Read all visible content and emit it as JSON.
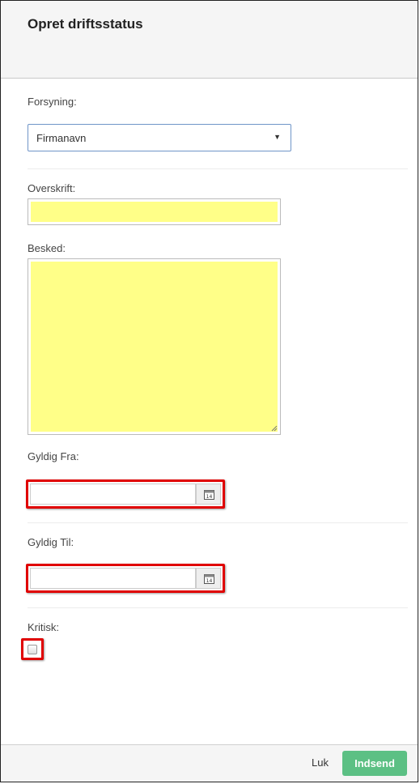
{
  "modal": {
    "title": "Opret driftsstatus"
  },
  "form": {
    "supply": {
      "label": "Forsyning:",
      "selected": "Firmanavn"
    },
    "heading": {
      "label": "Overskrift:",
      "value": ""
    },
    "message": {
      "label": "Besked:",
      "value": ""
    },
    "valid_from": {
      "label": "Gyldig Fra:",
      "value": "",
      "calendar_icon": "calendar-icon"
    },
    "valid_to": {
      "label": "Gyldig Til:",
      "value": "",
      "calendar_icon": "calendar-icon"
    },
    "critical": {
      "label": "Kritisk:",
      "checked": false
    }
  },
  "footer": {
    "close_label": "Luk",
    "submit_label": "Indsend"
  },
  "colors": {
    "highlight_fill": "#ffff88",
    "annotation_red": "#e00000",
    "submit_green": "#5cc084",
    "select_border": "#6f95c8"
  }
}
